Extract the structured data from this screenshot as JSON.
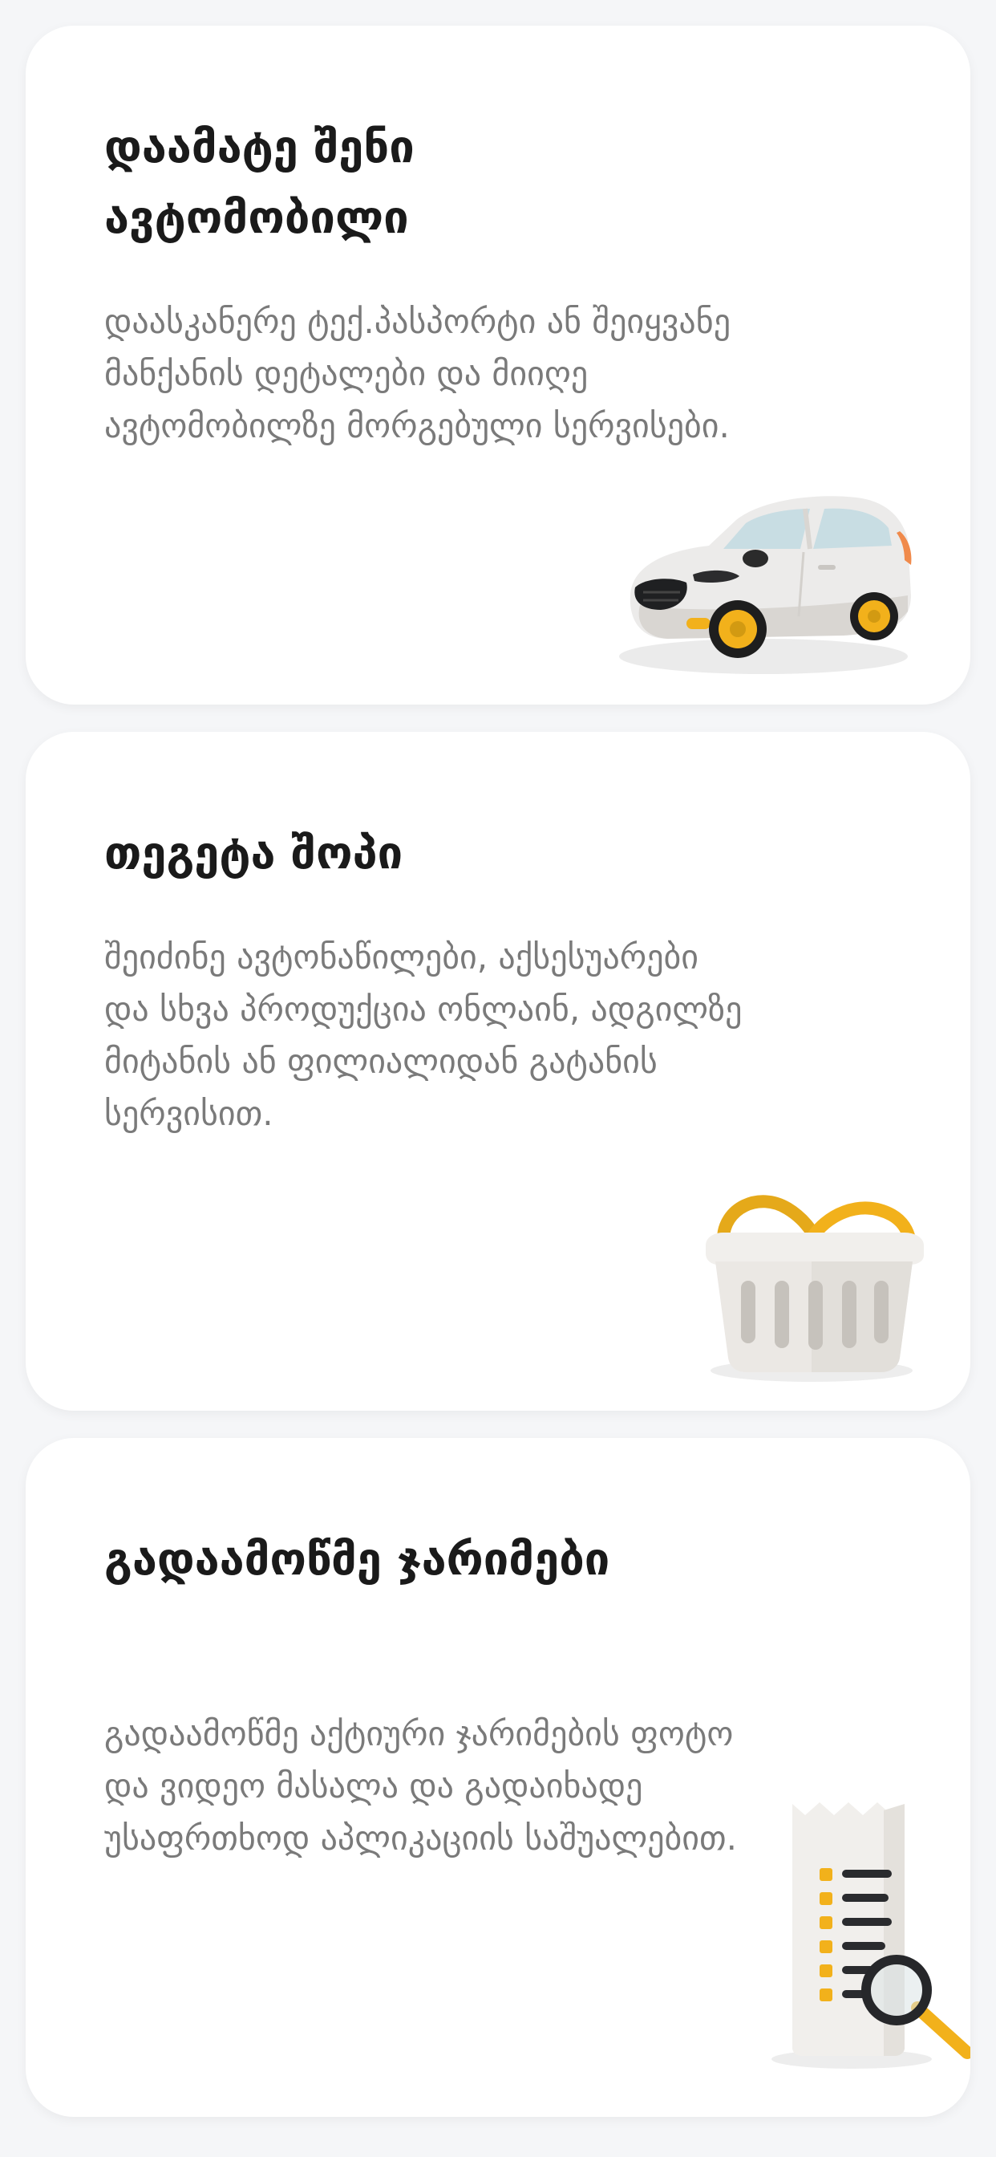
{
  "cards": [
    {
      "title": "დაამატე შენი ავტომობილი",
      "description": "დაასკანერე ტექ.პასპორტი ან შეიყვანე მანქანის დეტალები და მიიღე ავტომობილზე მორგებული სერვისები.",
      "icon": "car-icon"
    },
    {
      "title": "თეგეტა შოპი",
      "description": "შეიძინე ავტონაწილები, აქსესუარები და სხვა პროდუქცია ონლაინ, ადგილზე მიტანის ან ფილიალიდან გატანის სერვისით.",
      "icon": "shopping-basket-icon"
    },
    {
      "title": "გადაამოწმე ჯარიმები",
      "description": "გადაამოწმე აქტიური ჯარიმების ფოტო და ვიდეო მასალა და გადაიხადე უსაფრთხოდ აპლიკაციის საშუალებით.",
      "icon": "receipt-search-icon"
    }
  ],
  "colors": {
    "background": "#f5f6f8",
    "card": "#ffffff",
    "title": "#1a1a1a",
    "description": "#7a7a7a",
    "accent": "#f2b11b"
  }
}
